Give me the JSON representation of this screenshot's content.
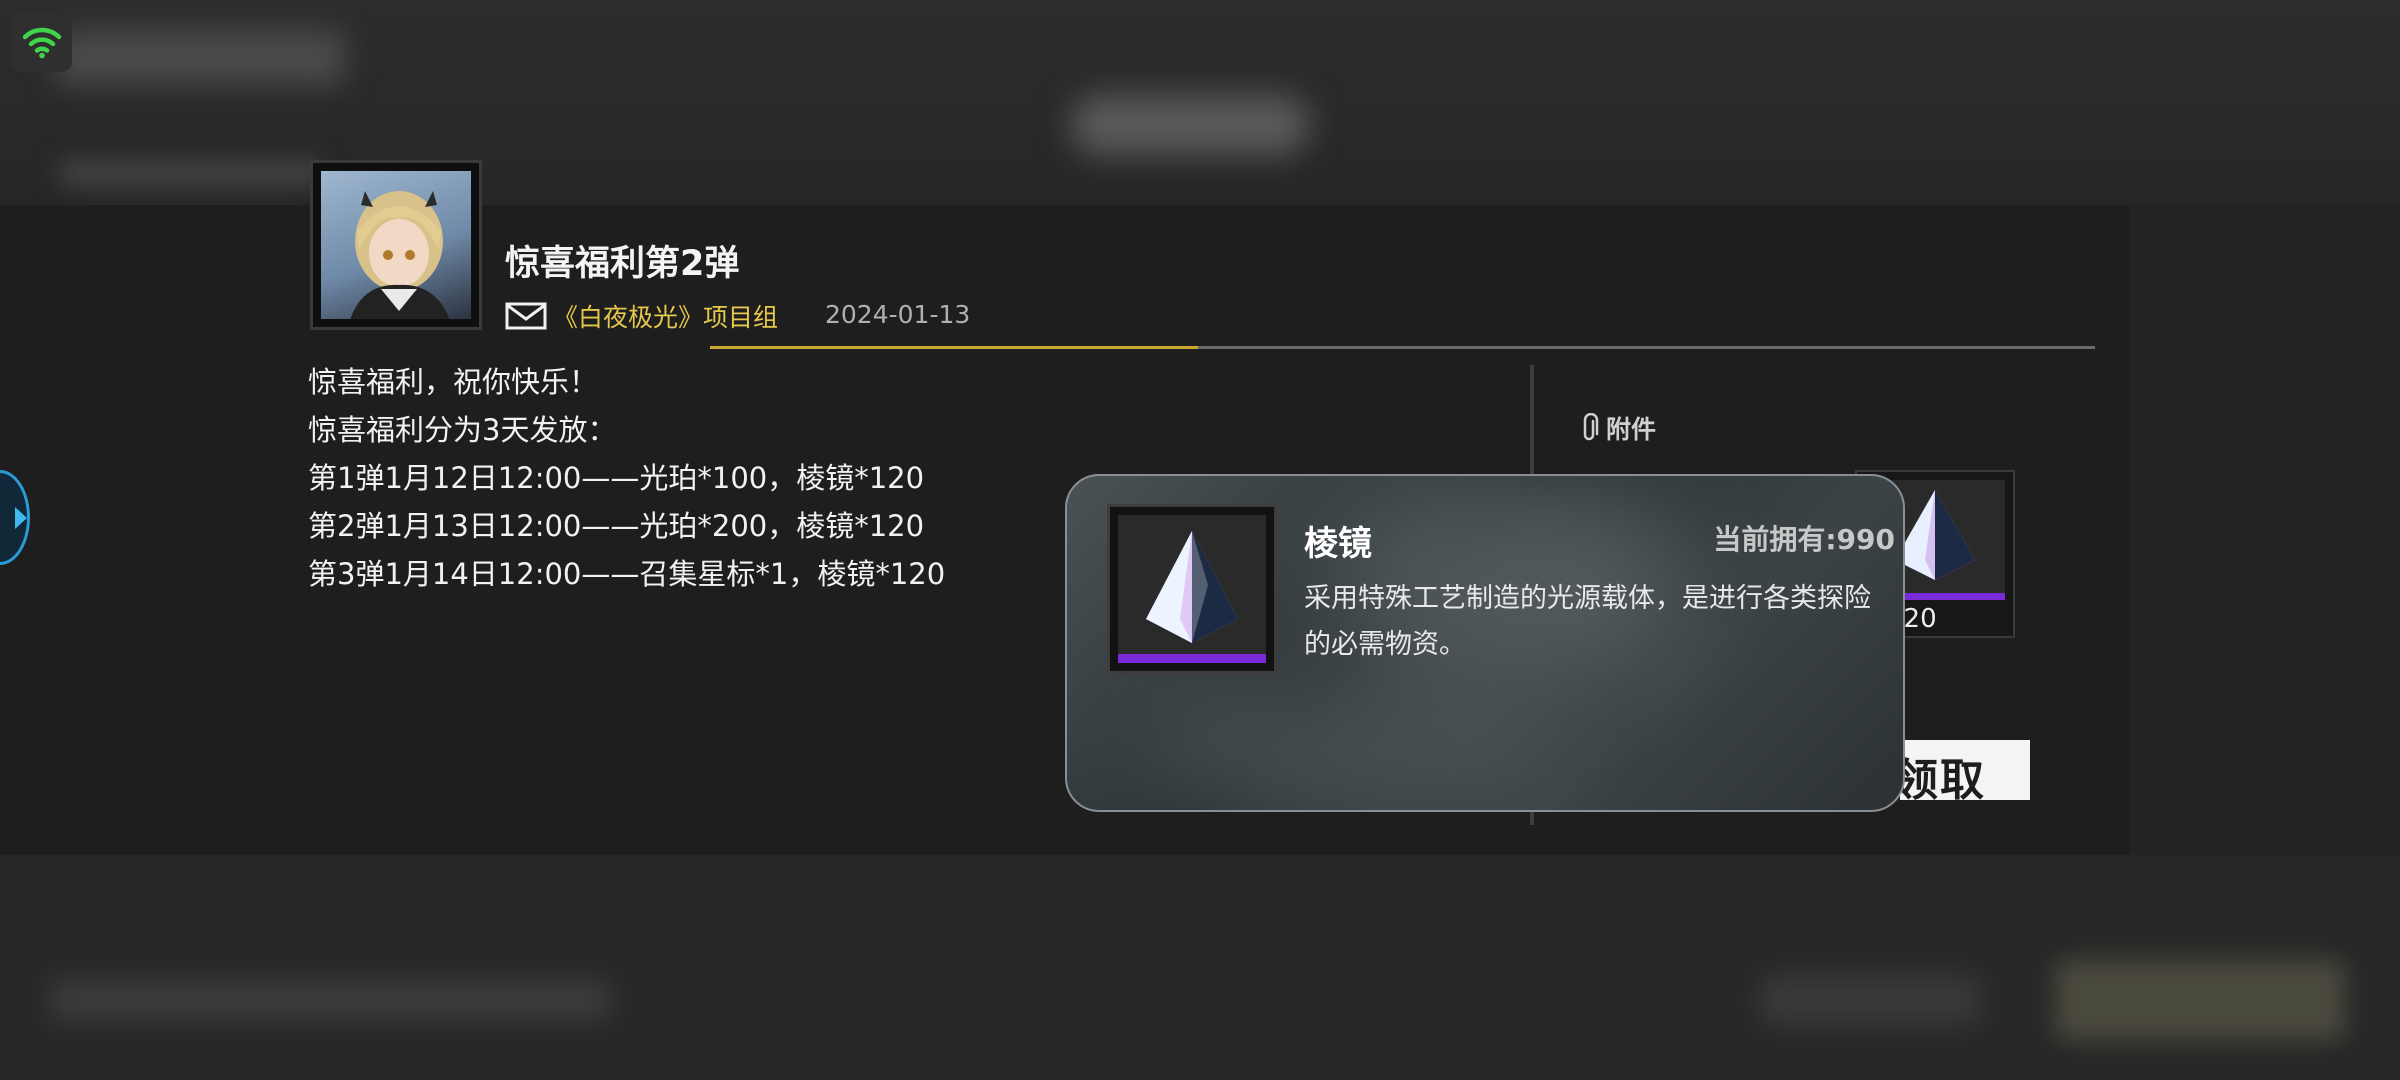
{
  "status": {
    "icon": "wifi-icon",
    "color": "#3fd44a"
  },
  "mail": {
    "title": "惊喜福利第2弹",
    "sender": "《白夜极光》项目组",
    "date": "2024-01-13",
    "body_lines": [
      "惊喜福利，祝你快乐！",
      "惊喜福利分为3天发放：",
      "第1弹1月12日12:00——光珀*100，棱镜*120",
      "第2弹1月13日12:00——光珀*200，棱镜*120",
      "第3弹1月14日12:00——召集星标*1，棱镜*120"
    ],
    "attachments_label": "附件",
    "attachment": {
      "icon": "prism-icon",
      "quantity": "120"
    },
    "partial_button_text": "领取"
  },
  "tooltip": {
    "item_name": "棱镜",
    "owned": "当前拥有:990",
    "description": "采用特殊工艺制造的光源载体，是进行各类探险的必需物资。",
    "rarity_color": "#7a2ad8"
  },
  "colors": {
    "accent": "#c9a82f",
    "sender": "#e6c84a",
    "nav": "#2a9bd8"
  }
}
